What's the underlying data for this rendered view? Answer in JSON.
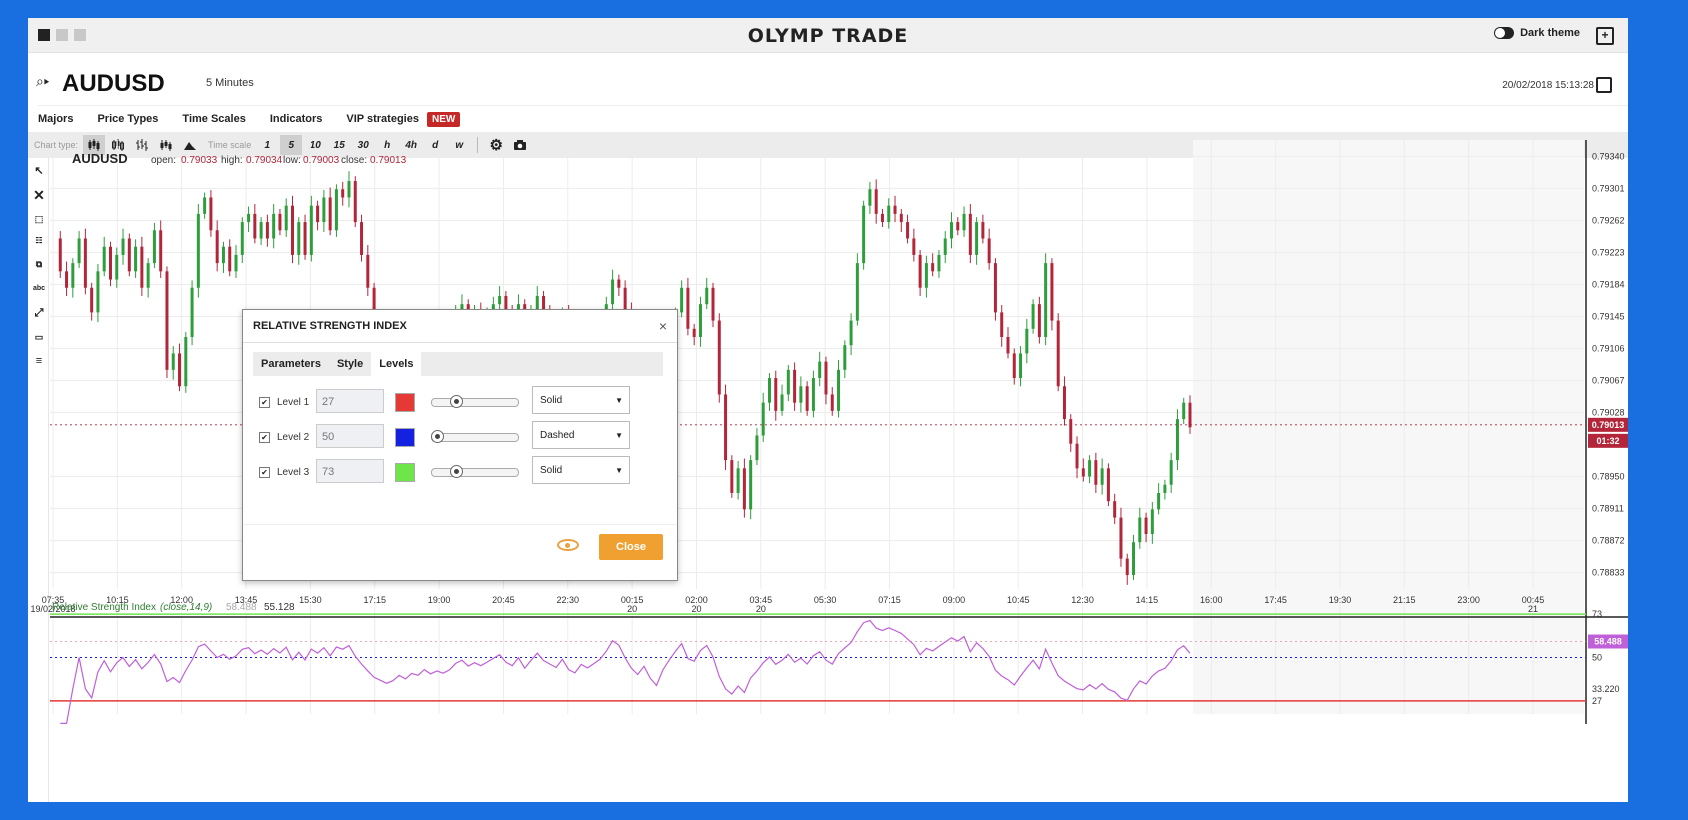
{
  "topbar": {
    "logo": "OLYMP TRADE",
    "theme_label": "Dark theme"
  },
  "symbol": {
    "name": "AUDUSD",
    "timeframe": "5 Minutes",
    "datetime": "20/02/2018 15:13:28"
  },
  "menu": {
    "items": [
      "Majors",
      "Price Types",
      "Time Scales",
      "Indicators",
      "VIP strategies"
    ],
    "new_badge": "NEW"
  },
  "toolbar": {
    "chart_type_label": "Chart type:",
    "time_scale_label": "Time scale",
    "time_scales": [
      "1",
      "5",
      "10",
      "15",
      "30",
      "h",
      "4h",
      "d",
      "w"
    ],
    "active_scale": "5"
  },
  "chart_info": {
    "symbol": "AUDUSD",
    "open_label": "open:",
    "open": "0.79033",
    "high_label": "high:",
    "high": "0.79034",
    "low_label": "low:",
    "low": "0.79003",
    "close_label": "close:",
    "close": "0.79013"
  },
  "rsi_info": {
    "label": "Relative Strength Index",
    "params": "(close,14,9)",
    "value1": "58.488",
    "value2": "55.128"
  },
  "chart_data": {
    "type": "candlestick",
    "y_ticks": [
      "0.79340",
      "0.79301",
      "0.79262",
      "0.79223",
      "0.79184",
      "0.79145",
      "0.79106",
      "0.79067",
      "0.79028",
      "0.78950",
      "0.78911",
      "0.78872",
      "0.78833"
    ],
    "ylim": [
      0.78813,
      0.7936
    ],
    "price_label": "0.79013",
    "countdown": "01:32",
    "x_ticks": [
      {
        "t": "07:35",
        "d": "19/02/2018"
      },
      {
        "t": "10:15",
        "d": ""
      },
      {
        "t": "12:00",
        "d": ""
      },
      {
        "t": "13:45",
        "d": ""
      },
      {
        "t": "15:30",
        "d": ""
      },
      {
        "t": "17:15",
        "d": ""
      },
      {
        "t": "19:00",
        "d": ""
      },
      {
        "t": "20:45",
        "d": ""
      },
      {
        "t": "22:30",
        "d": ""
      },
      {
        "t": "00:15",
        "d": "20"
      },
      {
        "t": "02:00",
        "d": "20"
      },
      {
        "t": "03:45",
        "d": "20"
      },
      {
        "t": "05:30",
        "d": ""
      },
      {
        "t": "07:15",
        "d": ""
      },
      {
        "t": "09:00",
        "d": ""
      },
      {
        "t": "10:45",
        "d": ""
      },
      {
        "t": "12:30",
        "d": ""
      },
      {
        "t": "14:15",
        "d": ""
      },
      {
        "t": "16:00",
        "d": ""
      },
      {
        "t": "17:45",
        "d": ""
      },
      {
        "t": "19:30",
        "d": ""
      },
      {
        "t": "21:15",
        "d": ""
      },
      {
        "t": "23:00",
        "d": ""
      },
      {
        "t": "00:45",
        "d": "21"
      }
    ],
    "price_path": [
      0.7924,
      0.792,
      0.7918,
      0.7921,
      0.7924,
      0.7918,
      0.7915,
      0.792,
      0.7923,
      0.7919,
      0.7922,
      0.7924,
      0.792,
      0.7923,
      0.7918,
      0.7921,
      0.7925,
      0.792,
      0.7908,
      0.791,
      0.7906,
      0.7912,
      0.7918,
      0.7927,
      0.7929,
      0.7925,
      0.7921,
      0.7923,
      0.792,
      0.7922,
      0.7926,
      0.7927,
      0.7924,
      0.7926,
      0.7924,
      0.7927,
      0.7925,
      0.7928,
      0.7922,
      0.7926,
      0.7922,
      0.7928,
      0.7926,
      0.7929,
      0.7925,
      0.793,
      0.7929,
      0.7931,
      0.7926,
      0.7922,
      0.7918,
      0.7914,
      0.7912,
      0.791,
      0.7911,
      0.7913,
      0.7911,
      0.7913,
      0.7912,
      0.7914,
      0.7912,
      0.7913,
      0.7912,
      0.7913,
      0.7915,
      0.7916,
      0.7914,
      0.7915,
      0.7914,
      0.7915,
      0.7916,
      0.7917,
      0.7915,
      0.7914,
      0.7916,
      0.7913,
      0.7915,
      0.7917,
      0.7915,
      0.7914,
      0.7913,
      0.7915,
      0.7912,
      0.7911,
      0.7913,
      0.7912,
      0.7913,
      0.7914,
      0.7916,
      0.7919,
      0.7918,
      0.7915,
      0.7912,
      0.791,
      0.7912,
      0.7908,
      0.7905,
      0.7909,
      0.7912,
      0.7915,
      0.7918,
      0.7913,
      0.7912,
      0.7916,
      0.7918,
      0.7914,
      0.7905,
      0.7897,
      0.7893,
      0.7896,
      0.7891,
      0.7897,
      0.79,
      0.7904,
      0.7907,
      0.7903,
      0.7905,
      0.7908,
      0.7904,
      0.7906,
      0.7903,
      0.7907,
      0.7909,
      0.7905,
      0.7903,
      0.7908,
      0.7911,
      0.7914,
      0.7921,
      0.7928,
      0.793,
      0.7927,
      0.7926,
      0.7928,
      0.7927,
      0.7926,
      0.7924,
      0.7922,
      0.7918,
      0.7921,
      0.792,
      0.7922,
      0.7924,
      0.7926,
      0.7925,
      0.7927,
      0.7922,
      0.7926,
      0.7924,
      0.7921,
      0.7915,
      0.7912,
      0.791,
      0.7907,
      0.791,
      0.7913,
      0.7916,
      0.7912,
      0.7921,
      0.7914,
      0.7906,
      0.7902,
      0.7899,
      0.7896,
      0.7895,
      0.7897,
      0.7894,
      0.7896,
      0.7892,
      0.789,
      0.7885,
      0.7883,
      0.7887,
      0.789,
      0.7888,
      0.7891,
      0.7893,
      0.7894,
      0.7897,
      0.7902,
      0.7904,
      0.7901
    ],
    "rsi_ticks": [
      "73",
      "50",
      "33.220",
      "27"
    ],
    "rsi_ylim": [
      20,
      80
    ],
    "rsi_value_label": "58.488",
    "levels": [
      27,
      50,
      73
    ]
  },
  "dialog": {
    "title": "RELATIVE STRENGTH INDEX",
    "tabs": [
      "Parameters",
      "Style",
      "Levels"
    ],
    "active_tab": "Levels",
    "levels": [
      {
        "label": "Level 1",
        "value": "27",
        "color": "#e53935",
        "style": "Solid",
        "slider": 0.25
      },
      {
        "label": "Level 2",
        "value": "50",
        "color": "#1421e0",
        "style": "Dashed",
        "slider": 0.0
      },
      {
        "label": "Level 3",
        "value": "73",
        "color": "#6ee64a",
        "style": "Solid",
        "slider": 0.25
      }
    ],
    "close_label": "Close"
  }
}
